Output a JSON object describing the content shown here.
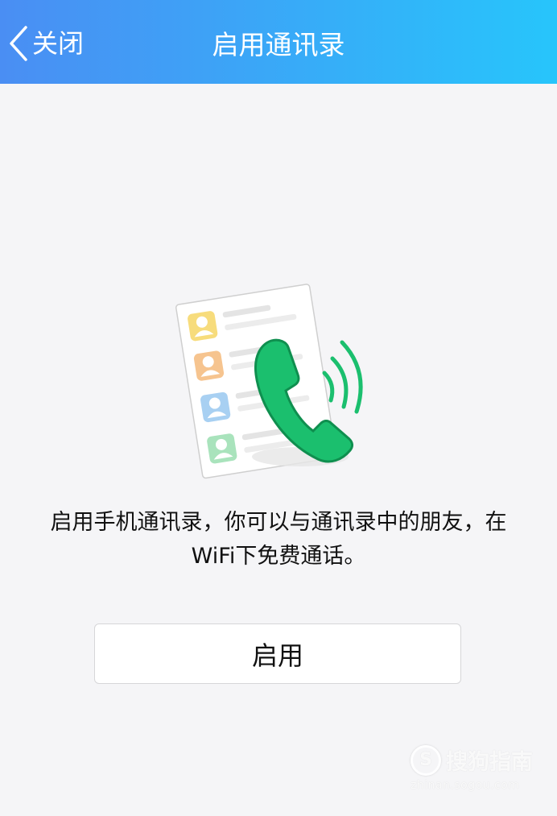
{
  "navbar": {
    "back_label": "关闭",
    "title": "启用通讯录",
    "gradient_start": "#4a8ef3",
    "gradient_end": "#27c5fb"
  },
  "illustration": {
    "icon": "contacts-phone-illustration",
    "contact_avatar_colors": [
      "#f7dc7c",
      "#f6c48f",
      "#a8d0f2",
      "#a9e3bc"
    ],
    "phone_color": "#1bbf6e"
  },
  "description": {
    "line1": "启用手机通讯录，你可以与通讯录中的朋友，在",
    "line2": "WiFi下免费通话。"
  },
  "enable_button": {
    "label": "启用"
  },
  "watermark": {
    "logo_letter": "S",
    "brand": "搜狗指南",
    "url": "zhinan.sogou.com"
  }
}
